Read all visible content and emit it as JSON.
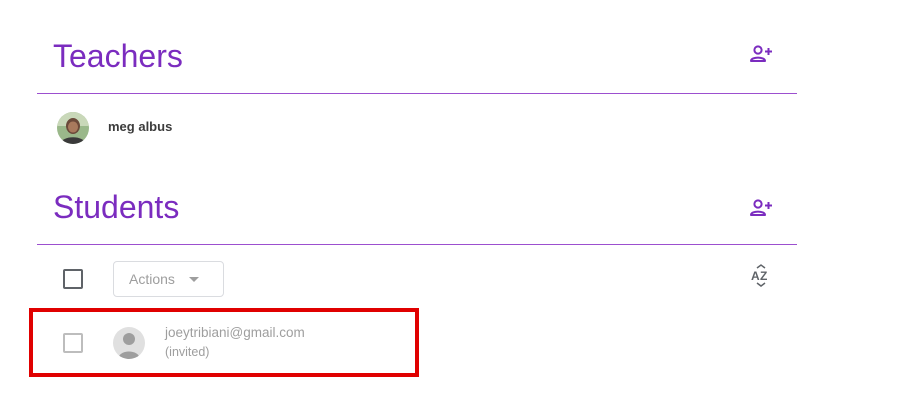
{
  "teachers": {
    "heading": "Teachers",
    "add_icon": "person-add-icon",
    "list": [
      {
        "name": "meg albus",
        "avatar": "profile-photo"
      }
    ]
  },
  "students": {
    "heading": "Students",
    "add_icon": "person-add-icon",
    "actions_label": "Actions",
    "sort_icon": "sort-az-icon",
    "list": [
      {
        "email": "joeytribiani@gmail.com",
        "status": "(invited)",
        "avatar": "default-person-icon"
      }
    ]
  },
  "colors": {
    "accent": "#7b2cbf",
    "divider": "#9c4fcf",
    "highlight": "#e00000",
    "muted_text": "#9e9e9e"
  }
}
